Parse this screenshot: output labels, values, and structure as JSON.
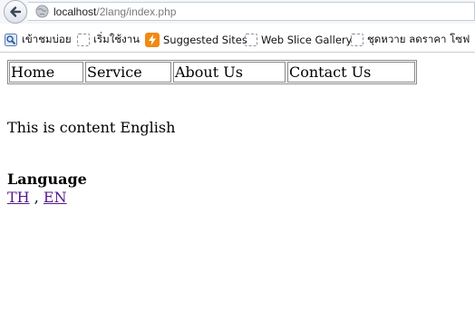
{
  "browser": {
    "url_host": "localhost",
    "url_path": "/2lang/index.php",
    "back_icon": "back-arrow-icon",
    "site_icon": "globe-icon"
  },
  "bookmarks": {
    "items": [
      {
        "label": "เข้าชมบ่อย",
        "icon": "magnifier-page-icon"
      },
      {
        "label": "เริ่มใช้งาน",
        "icon": "page-icon"
      },
      {
        "label": "Suggested Sites",
        "icon": "suggested-sites-icon"
      },
      {
        "label": "Web Slice Gallery",
        "icon": "page-icon"
      },
      {
        "label": "ชุดหวาย ลดราคา โซฟ",
        "icon": "page-icon"
      }
    ]
  },
  "menu": {
    "items": [
      {
        "label": "Home"
      },
      {
        "label": "Service"
      },
      {
        "label": "About Us"
      },
      {
        "label": "Contact Us"
      }
    ]
  },
  "content": {
    "text": "This is content English"
  },
  "language": {
    "heading": "Language",
    "links": [
      {
        "label": "TH"
      },
      {
        "label": "EN"
      }
    ],
    "separator": " , ",
    "link_color": "#551a8b"
  }
}
